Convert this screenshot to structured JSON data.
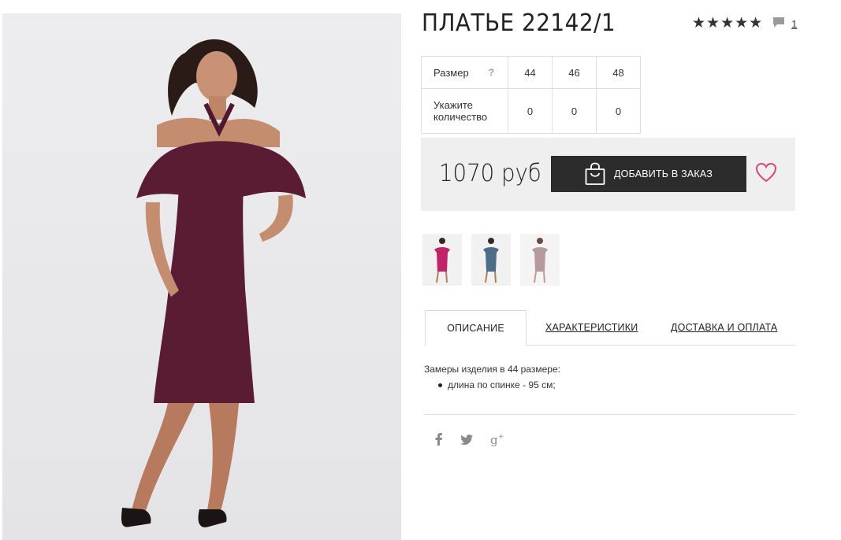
{
  "product": {
    "title": "ПЛАТЬЕ 22142/1",
    "rating_stars": "★★★★★",
    "comment_count": "1"
  },
  "sizes": {
    "size_label": "Размер",
    "help": "?",
    "quantity_label": "Укажите количество",
    "options": [
      "44",
      "46",
      "48"
    ],
    "quantities": [
      "0",
      "0",
      "0"
    ]
  },
  "buy": {
    "price": "1070 руб",
    "add_label": "ДОБАВИТЬ В ЗАКАЗ"
  },
  "thumbnails": [
    {
      "color": "#c2246a"
    },
    {
      "color": "#4f6c86"
    },
    {
      "color": "#b79a9e"
    }
  ],
  "tabs": [
    {
      "label": "ОПИСАНИЕ"
    },
    {
      "label": "ХАРАКТЕРИСТИКИ"
    },
    {
      "label": "ДОСТАВКА И ОПЛАТА"
    }
  ],
  "description": {
    "intro": "Замеры изделия в 44 размере:",
    "items": [
      "длина по спинке - 95 см;"
    ]
  },
  "colors": {
    "dress": "#5a1c32",
    "button": "#2c2c2c",
    "heart": "#d9457a",
    "buybox": "#efefef"
  }
}
